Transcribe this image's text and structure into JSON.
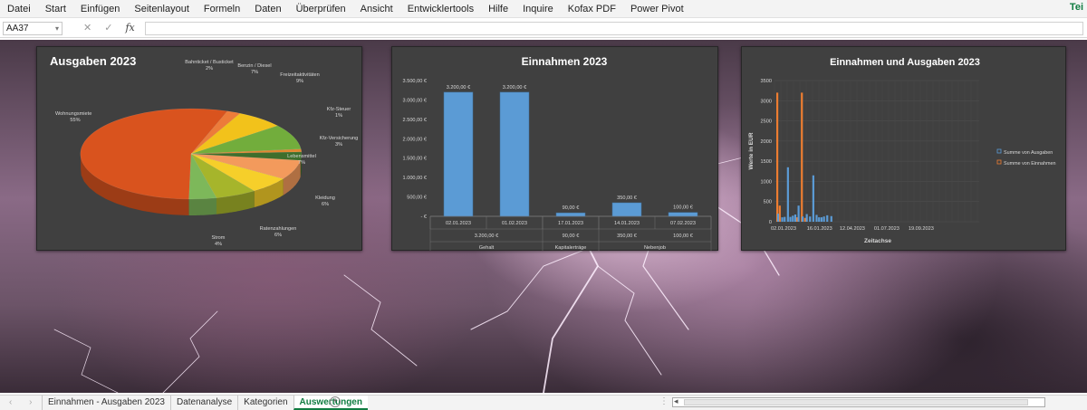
{
  "ribbon": {
    "tabs": [
      "Datei",
      "Start",
      "Einfügen",
      "Seitenlayout",
      "Formeln",
      "Daten",
      "Überprüfen",
      "Ansicht",
      "Entwicklertools",
      "Hilfe",
      "Inquire",
      "Kofax PDF",
      "Power Pivot"
    ],
    "share_label": "Tei"
  },
  "formula_bar": {
    "name_box": "AA37",
    "fx": "fx",
    "cancel": "✕",
    "confirm": "✓"
  },
  "sheet_tabs": {
    "tabs": [
      "Einnahmen - Ausgaben 2023",
      "Datenanalyse",
      "Kategorien",
      "Auswertungen"
    ],
    "active": "Auswertungen",
    "add_label": "+",
    "nav": "‹ ›",
    "more": "⋮"
  },
  "colors": {
    "accent": "#107c41",
    "chart_bg": "#404040",
    "bar_blue": "#5b9bd5",
    "bar_orange": "#ed7d31"
  },
  "chart_data": [
    {
      "type": "pie",
      "title": "Ausgaben 2023",
      "slices": [
        {
          "label": "Wohnungsmiete",
          "pct": "55%",
          "value": 55,
          "color": "#d9531e"
        },
        {
          "label": "Bahnticket / Busticket",
          "pct": "2%",
          "value": 2,
          "color": "#ec7b3a"
        },
        {
          "label": "Benzin / Diesel",
          "pct": "7%",
          "value": 7,
          "color": "#f2c21b"
        },
        {
          "label": "Freizeitaktivitäten",
          "pct": "9%",
          "value": 9,
          "color": "#72ad3c"
        },
        {
          "label": "Kfz-Steuer",
          "pct": "1%",
          "value": 1,
          "color": "#e3862f"
        },
        {
          "label": "Kfz-Versicherung",
          "pct": "3%",
          "value": 3,
          "color": "#3f6e2c"
        },
        {
          "label": "Lebensmittel",
          "pct": "7%",
          "value": 7,
          "color": "#f39a5c"
        },
        {
          "label": "Kleidung",
          "pct": "6%",
          "value": 6,
          "color": "#f6cf2a"
        },
        {
          "label": "Ratenzahlungen",
          "pct": "6%",
          "value": 6,
          "color": "#a6b52b"
        },
        {
          "label": "Strom",
          "pct": "4%",
          "value": 4,
          "color": "#7db85a"
        }
      ]
    },
    {
      "type": "bar",
      "title": "Einnahmen 2023",
      "y_ticks": [
        "3.500,00 €",
        "3.000,00 €",
        "2.500,00 €",
        "2.000,00 €",
        "1.500,00 €",
        "1.000,00 €",
        "500,00 €",
        "-   €"
      ],
      "ylim": [
        0,
        3500
      ],
      "bars": [
        {
          "date": "02.01.2023",
          "value": 3200,
          "label": "3.200,00 €"
        },
        {
          "date": "01.02.2023",
          "value": 3200,
          "label": "3.200,00 €"
        },
        {
          "date": "17.01.2023",
          "value": 90,
          "label": "90,00 €"
        },
        {
          "date": "14.01.2023",
          "value": 350,
          "label": "350,00 €"
        },
        {
          "date": "07.02.2023",
          "value": 100,
          "label": "100,00 €"
        }
      ],
      "groups": [
        {
          "name": "Gehalt",
          "subtotal": "3.200,00 €",
          "bars": [
            0,
            1
          ]
        },
        {
          "name": "Kapitalerträge",
          "subtotal": "90,00 €",
          "bars": [
            2
          ]
        },
        {
          "name": "Nebenjob",
          "subtotal": "350,00 €",
          "bars": [
            3
          ]
        },
        {
          "name": "",
          "subtotal": "100,00 €",
          "bars": [
            4
          ]
        }
      ]
    },
    {
      "type": "bar",
      "title": "Einnahmen und Ausgaben 2023",
      "ylabel": "Werte in EUR",
      "xlabel": "Zeitachse",
      "ylim": [
        0,
        3500
      ],
      "y_ticks": [
        "3500",
        "3000",
        "2500",
        "2000",
        "1500",
        "1000",
        "500",
        "0"
      ],
      "x_ticks": [
        "02.01.2023",
        "16.01.2023",
        "12.04.2023",
        "01.07.2023",
        "19.09.2023"
      ],
      "legend": [
        "Summe von Ausgaben",
        "Summe von Einnahmen"
      ],
      "legend_position": "right",
      "series": [
        {
          "name": "Summe von Einnahmen",
          "color": "#ed7d31",
          "points": [
            [
              0,
              3200
            ],
            [
              3,
              400
            ],
            [
              24,
              110
            ],
            [
              30,
              3200
            ],
            [
              34,
              95
            ]
          ]
        },
        {
          "name": "Summe von Ausgaben",
          "color": "#5b9bd5",
          "points": [
            [
              1,
              200
            ],
            [
              6,
              110
            ],
            [
              9,
              120
            ],
            [
              13,
              1350
            ],
            [
              16,
              120
            ],
            [
              19,
              150
            ],
            [
              22,
              180
            ],
            [
              26,
              400
            ],
            [
              31,
              130
            ],
            [
              36,
              190
            ],
            [
              40,
              130
            ],
            [
              44,
              1150
            ],
            [
              48,
              170
            ],
            [
              51,
              110
            ],
            [
              54,
              110
            ],
            [
              57,
              130
            ],
            [
              61,
              160
            ],
            [
              66,
              140
            ]
          ]
        }
      ],
      "x_span": 250
    }
  ]
}
